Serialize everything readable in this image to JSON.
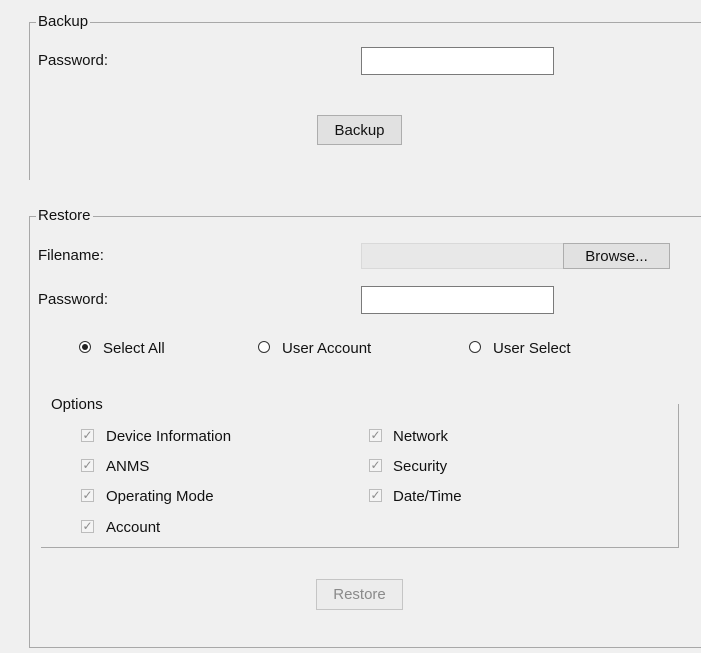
{
  "backup": {
    "group_title": "Backup",
    "password_label": "Password:",
    "password_value": "",
    "button_label": "Backup"
  },
  "restore": {
    "group_title": "Restore",
    "filename_label": "Filename:",
    "filename_value": "",
    "browse_label": "Browse...",
    "password_label": "Password:",
    "password_value": "",
    "radios": [
      {
        "label": "Select All",
        "checked": true
      },
      {
        "label": "User Account",
        "checked": false
      },
      {
        "label": "User Select",
        "checked": false
      }
    ],
    "options": {
      "title": "Options",
      "items": [
        {
          "label": "Device Information",
          "checked": true,
          "enabled": false
        },
        {
          "label": "ANMS",
          "checked": true,
          "enabled": false
        },
        {
          "label": "Operating Mode",
          "checked": true,
          "enabled": false
        },
        {
          "label": "Account",
          "checked": true,
          "enabled": false
        },
        {
          "label": "Network",
          "checked": true,
          "enabled": false
        },
        {
          "label": "Security",
          "checked": true,
          "enabled": false
        },
        {
          "label": "Date/Time",
          "checked": true,
          "enabled": false
        }
      ]
    },
    "button_label": "Restore",
    "button_enabled": false
  }
}
